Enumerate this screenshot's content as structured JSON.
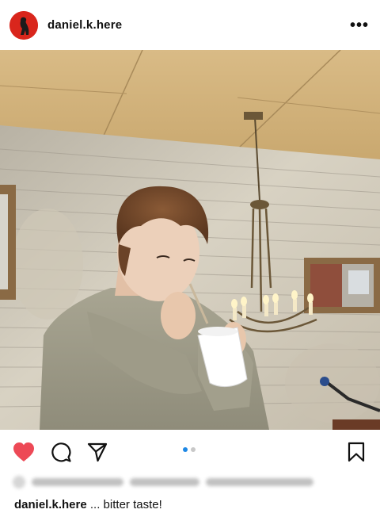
{
  "header": {
    "username": "daniel.k.here",
    "more_glyph": "•••"
  },
  "post": {
    "carousel": {
      "count": 2,
      "active_index": 0
    },
    "liked": true,
    "caption": {
      "username": "daniel.k.here",
      "text": " ... bitter taste!"
    }
  },
  "icons": {
    "like": "heart-filled-icon",
    "comment": "comment-bubble-icon",
    "share": "paper-plane-icon",
    "save": "bookmark-icon",
    "more": "more-horizontal-icon"
  },
  "colors": {
    "heart": "#ed4956",
    "carousel_active": "#1e88e5",
    "avatar": "#d9261c"
  }
}
